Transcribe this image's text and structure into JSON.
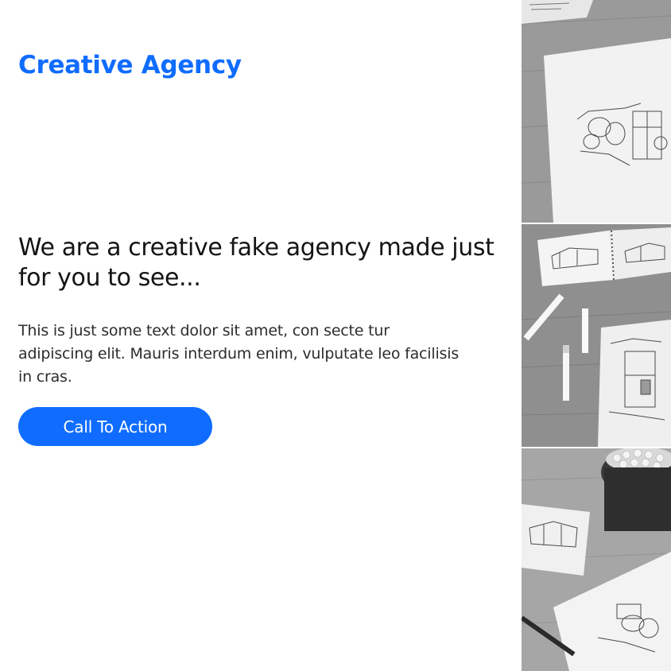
{
  "brand": {
    "name": "Creative Agency",
    "color": "#0f6cff"
  },
  "hero": {
    "headline": "We are a creative fake agency made just for you to see...",
    "description": "This is just some text dolor sit amet, con secte tur adipiscing elit. Mauris interdum enim, vulputate leo facilisis in cras.",
    "cta_label": "Call To Action"
  },
  "gallery": {
    "images": [
      {
        "subject": "architectural sketch on paper, grayscale"
      },
      {
        "subject": "sketchbook with building drawings and markers, grayscale"
      },
      {
        "subject": "marker cup beside sketches on wooden table, grayscale"
      }
    ]
  }
}
